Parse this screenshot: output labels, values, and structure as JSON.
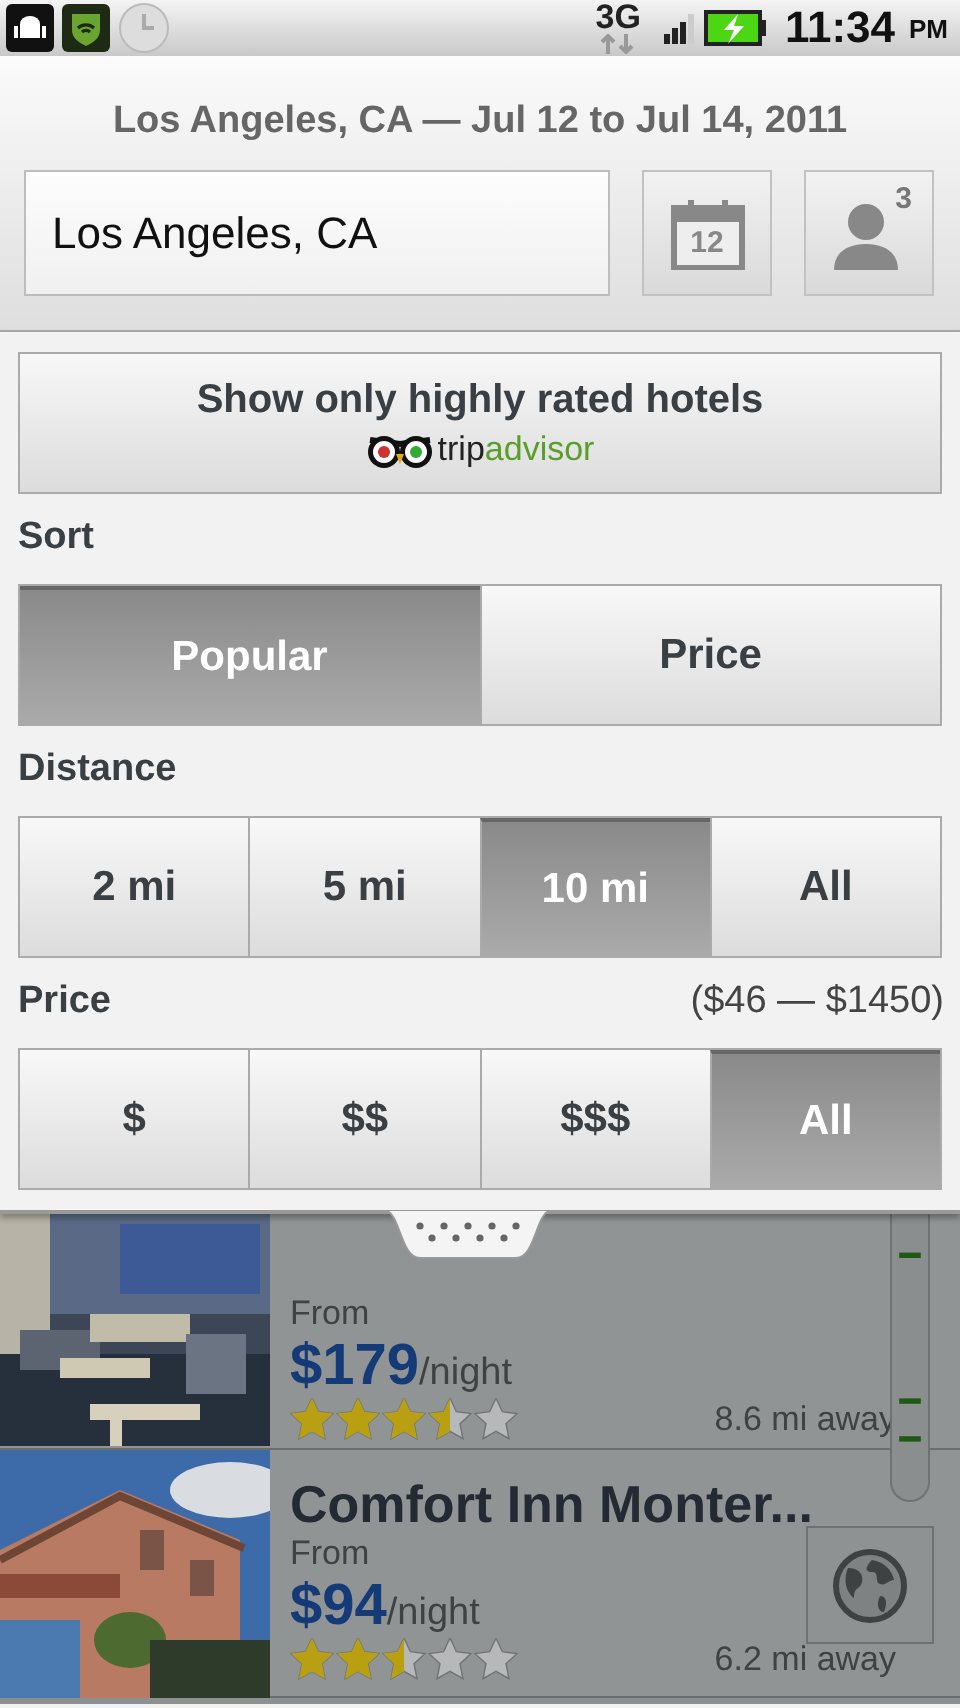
{
  "status_bar": {
    "network": "3G",
    "time": "11:34",
    "ampm": "PM"
  },
  "header": {
    "title": "Los Angeles, CA — Jul 12 to Jul 14, 2011",
    "location_field": {
      "value": "Los Angeles, CA"
    },
    "date_button": {
      "day": "12"
    },
    "guests_button": {
      "count": "3"
    }
  },
  "filters": {
    "rated_button": {
      "label": "Show only highly rated hotels",
      "brand": [
        "trip",
        "advisor"
      ]
    },
    "sort": {
      "label": "Sort",
      "options": [
        {
          "label": "Popular",
          "selected": true
        },
        {
          "label": "Price",
          "selected": false
        }
      ]
    },
    "distance": {
      "label": "Distance",
      "options": [
        {
          "label": "2 mi",
          "selected": false
        },
        {
          "label": "5 mi",
          "selected": false
        },
        {
          "label": "10 mi",
          "selected": true
        },
        {
          "label": "All",
          "selected": false
        }
      ]
    },
    "price": {
      "label": "Price",
      "range": "($46 — $1450)",
      "options": [
        {
          "label": "$",
          "selected": false
        },
        {
          "label": "$$",
          "selected": false
        },
        {
          "label": "$$$",
          "selected": false
        },
        {
          "label": "All",
          "selected": true
        }
      ]
    }
  },
  "hotels": [
    {
      "from": "From",
      "price": "$179",
      "unit": "/night",
      "stars": 3.5,
      "distance": "8.6 mi away"
    },
    {
      "name": "Comfort Inn Monter...",
      "from": "From",
      "price": "$94",
      "unit": "/night",
      "stars": 2.5,
      "distance": "6.2 mi away"
    }
  ]
}
